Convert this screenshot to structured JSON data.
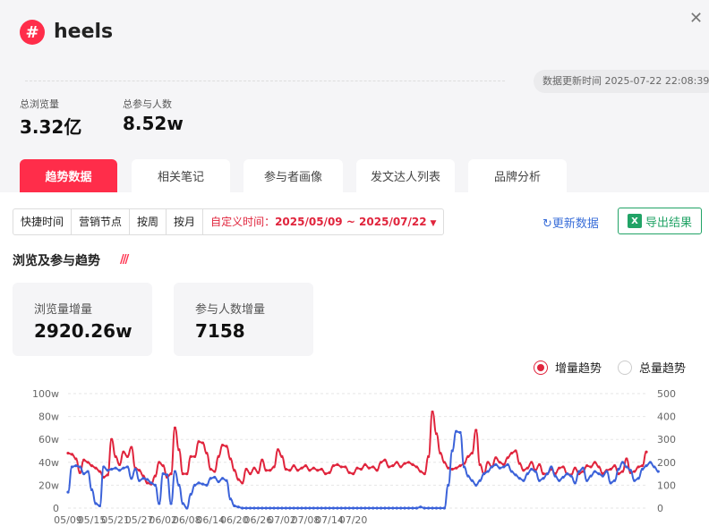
{
  "header": {
    "tag_symbol": "#",
    "title": "heels",
    "update_time": "数据更新时间 2025-07-22 22:08:39"
  },
  "stats": {
    "views_label": "总浏览量",
    "views_value": "3.32亿",
    "participants_label": "总参与人数",
    "participants_value": "8.52w"
  },
  "tabs": [
    {
      "label": "趋势数据",
      "active": true
    },
    {
      "label": "相关笔记",
      "active": false
    },
    {
      "label": "参与者画像",
      "active": false
    },
    {
      "label": "发文达人列表",
      "active": false
    },
    {
      "label": "品牌分析",
      "active": false
    }
  ],
  "toolbar": {
    "quick_time": "快捷时间",
    "marketing_nodes": "营销节点",
    "by_week": "按周",
    "by_month": "按月",
    "custom_label": "自定义时间：",
    "custom_value": "2025/05/09 ~ 2025/07/22",
    "refresh": "更新数据",
    "export": "导出结果",
    "export_icon": "X"
  },
  "section": {
    "title": "浏览及参与趋势"
  },
  "cards": {
    "views_inc_label": "浏览量增量",
    "views_inc_value": "2920.26w",
    "part_inc_label": "参与人数增量",
    "part_inc_value": "7158"
  },
  "mode": {
    "incremental": "增量趋势",
    "total": "总量趋势",
    "selected": "incremental"
  },
  "colors": {
    "views": "#e0243c",
    "participants": "#3b62d9"
  },
  "chart_data": {
    "type": "line",
    "x_ticks": [
      "05/09",
      "05/15",
      "05/21",
      "05/27",
      "06/02",
      "06/08",
      "06/14",
      "06/20",
      "06/26",
      "07/02",
      "07/08",
      "07/14",
      "07/20"
    ],
    "y_left_ticks": [
      "0",
      "20w",
      "40w",
      "60w",
      "80w",
      "100w"
    ],
    "y_right_ticks": [
      "0",
      "100",
      "200",
      "300",
      "400",
      "500"
    ],
    "ylim_left": [
      0,
      100
    ],
    "ylim_right": [
      0,
      500
    ],
    "grid": true,
    "series": [
      {
        "axis": "left",
        "values": [
          48,
          47,
          43,
          31,
          42,
          40,
          37,
          35,
          32,
          27,
          29,
          60,
          45,
          38,
          49,
          45,
          53,
          35,
          33,
          28,
          22,
          21,
          28,
          40,
          37,
          27,
          30,
          70,
          51,
          30,
          30,
          45,
          45,
          58,
          57,
          48,
          34,
          32,
          45,
          55,
          54,
          43,
          33,
          25,
          22,
          34,
          30,
          35,
          31,
          42,
          33,
          33,
          36,
          51,
          45,
          34,
          33,
          37,
          33,
          35,
          37,
          33,
          35,
          33,
          34,
          30,
          31,
          37,
          38,
          36,
          36,
          31,
          30,
          35,
          34,
          38,
          35,
          36,
          33,
          40,
          42,
          36,
          37,
          40,
          36,
          39,
          40,
          38,
          36,
          32,
          30,
          45,
          84,
          65,
          48,
          40,
          35,
          34,
          35,
          37,
          39,
          45,
          48,
          68,
          38,
          30,
          40,
          36,
          44,
          40,
          38,
          44,
          48,
          50,
          39,
          33,
          35,
          40,
          33,
          38,
          30,
          30,
          34,
          30,
          35,
          36,
          30,
          29,
          35,
          30,
          32,
          37,
          36,
          40,
          36,
          30,
          33,
          34,
          37,
          30,
          32,
          43,
          31,
          32,
          36,
          37,
          49
        ]
      },
      {
        "axis": "right",
        "values": [
          70,
          180,
          185,
          180,
          150,
          160,
          80,
          20,
          10,
          180,
          165,
          170,
          175,
          165,
          175,
          180,
          130,
          170,
          120,
          130,
          125,
          110,
          100,
          20,
          150,
          145,
          20,
          160,
          100,
          20,
          0,
          60,
          100,
          110,
          105,
          100,
          130,
          135,
          115,
          130,
          120,
          40,
          10,
          5,
          0,
          0,
          0,
          0,
          0,
          0,
          0,
          0,
          0,
          0,
          0,
          0,
          0,
          0,
          0,
          0,
          0,
          0,
          0,
          0,
          0,
          0,
          0,
          0,
          0,
          0,
          0,
          0,
          0,
          0,
          0,
          0,
          0,
          0,
          0,
          0,
          0,
          0,
          0,
          0,
          0,
          0,
          0,
          0,
          0,
          5,
          0,
          0,
          0,
          0,
          0,
          0,
          100,
          250,
          335,
          330,
          180,
          140,
          120,
          100,
          120,
          150,
          160,
          180,
          190,
          175,
          180,
          190,
          160,
          145,
          130,
          120,
          150,
          170,
          160,
          120,
          130,
          150,
          180,
          140,
          120,
          135,
          150,
          140,
          110,
          160,
          175,
          120,
          140,
          160,
          150,
          140,
          160,
          110,
          120,
          170,
          200,
          180,
          165,
          120,
          130,
          170,
          185,
          200,
          180,
          160
        ]
      }
    ]
  }
}
